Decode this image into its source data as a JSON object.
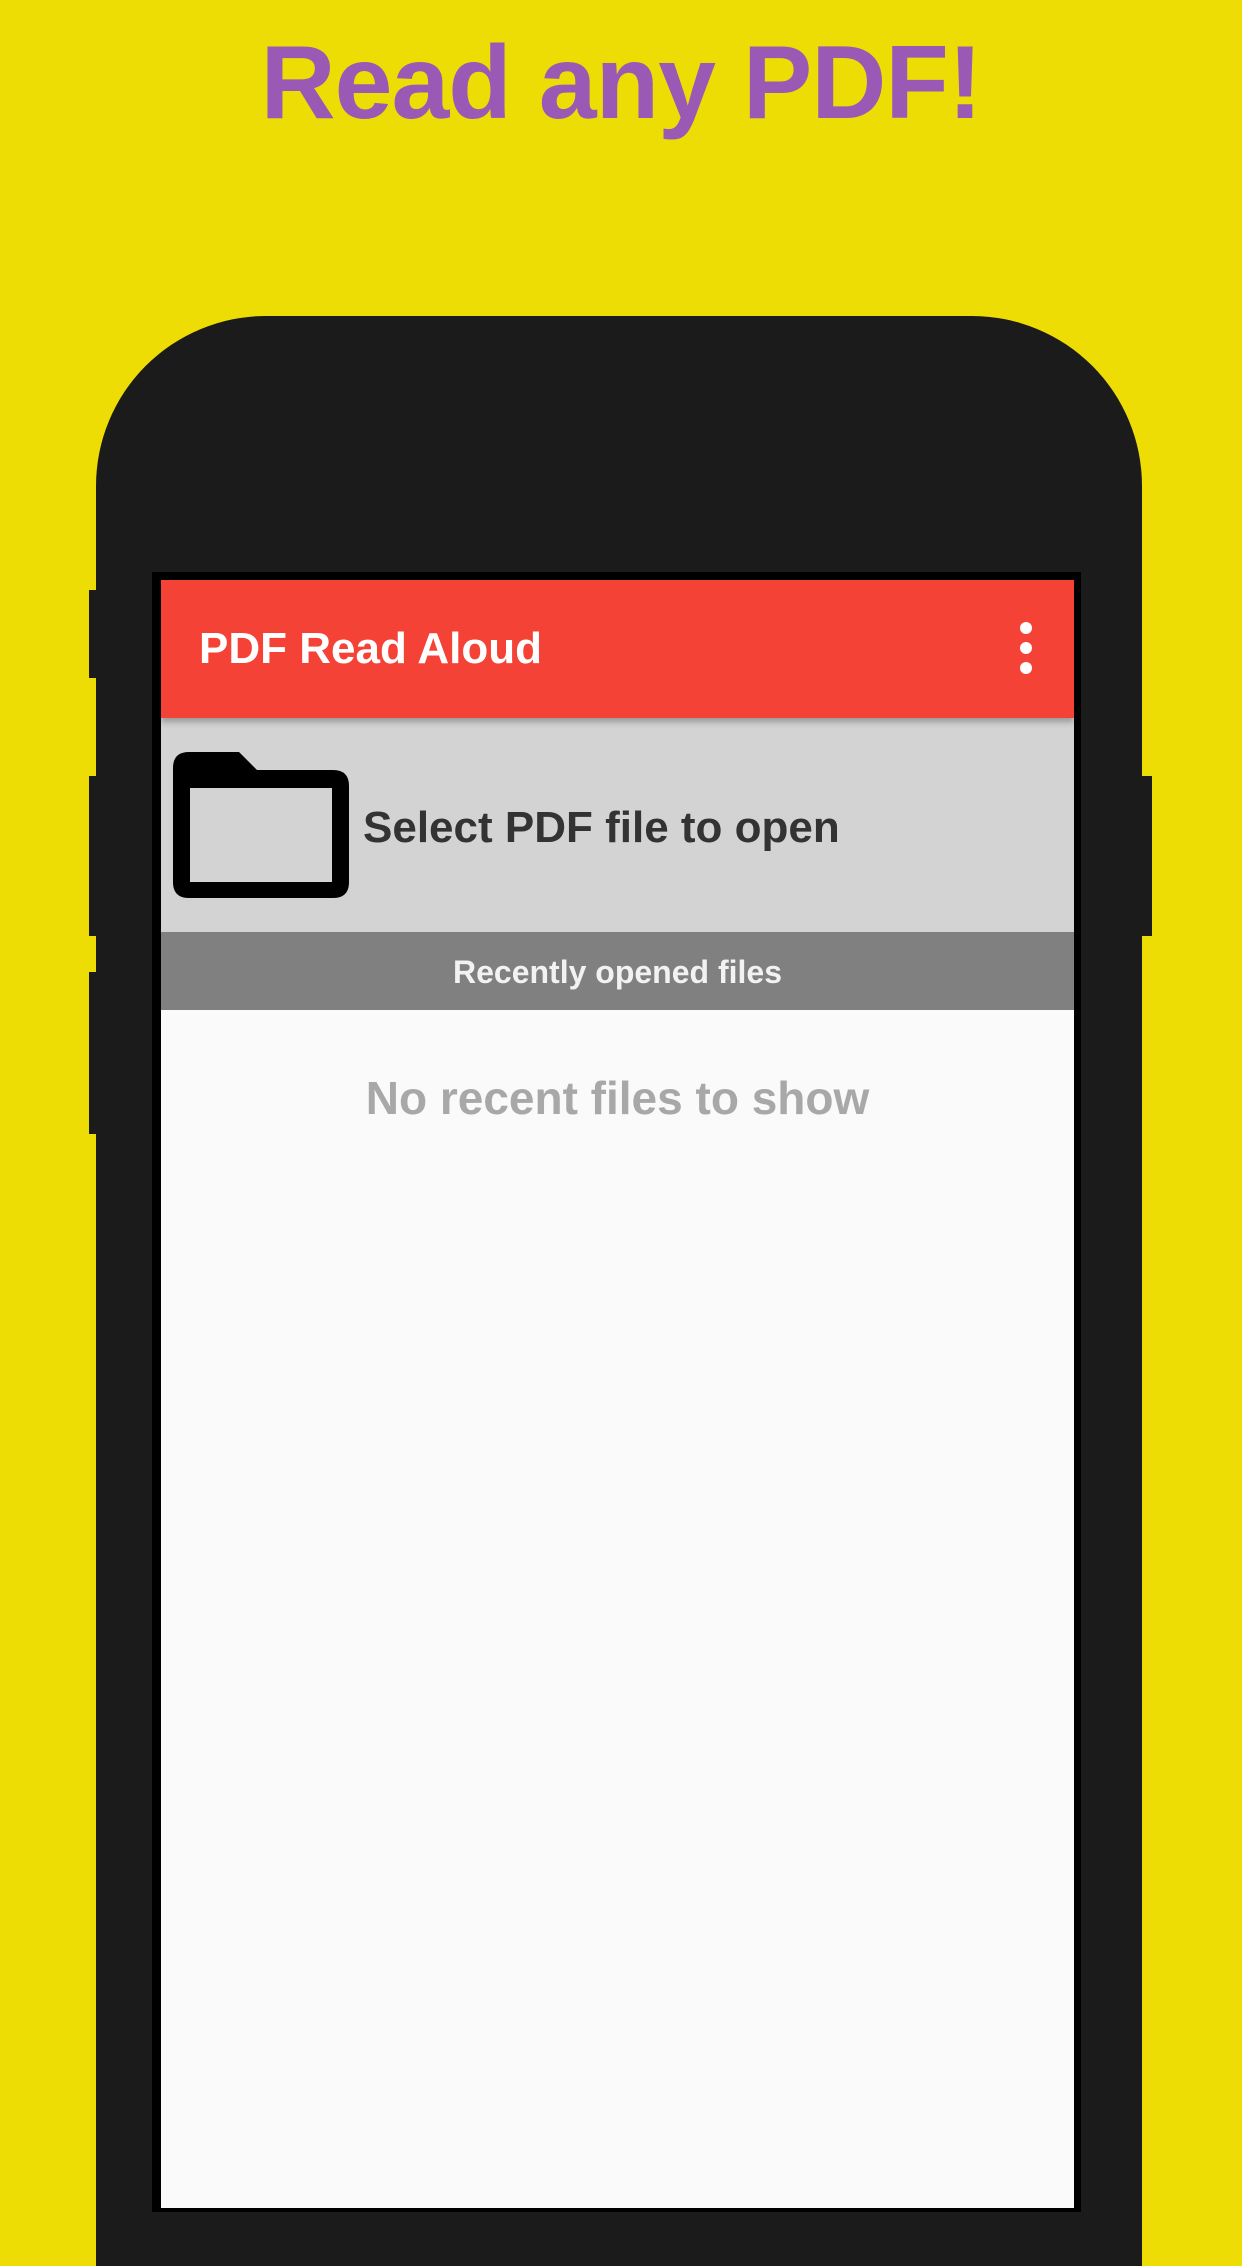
{
  "promo": {
    "headline": "Read any PDF!",
    "background_color": "#EEDD04",
    "headline_color": "#9B59B6"
  },
  "app_bar": {
    "title": "PDF Read Aloud",
    "color": "#F44336",
    "menu_icon": "more-vert-icon"
  },
  "select_file": {
    "icon": "folder-icon",
    "label": "Select PDF file to open"
  },
  "recent": {
    "header": "Recently opened files",
    "empty_message": "No recent files to show"
  }
}
